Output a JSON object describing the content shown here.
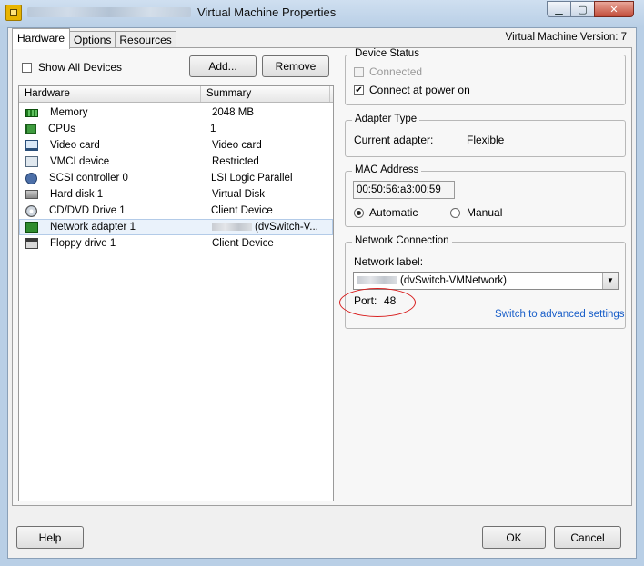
{
  "window": {
    "title": "Virtual Machine Properties",
    "controls": {
      "minimize": "▁",
      "maximize": "▢",
      "close": "✕"
    }
  },
  "tabs": [
    {
      "label": "Hardware",
      "active": true
    },
    {
      "label": "Options",
      "active": false
    },
    {
      "label": "Resources",
      "active": false
    }
  ],
  "vm_version": "Virtual Machine Version: 7",
  "left": {
    "show_all_devices_label": "Show All Devices",
    "add_button": "Add...",
    "remove_button": "Remove",
    "columns": {
      "hardware": "Hardware",
      "summary": "Summary"
    },
    "devices": [
      {
        "name": "Memory",
        "summary": "2048 MB",
        "icon": "memory-icon"
      },
      {
        "name": "CPUs",
        "summary": "1",
        "icon": "cpu-icon"
      },
      {
        "name": "Video card",
        "summary": "Video card",
        "icon": "monitor-icon"
      },
      {
        "name": "VMCI device",
        "summary": "Restricted",
        "icon": "vmci-icon"
      },
      {
        "name": "SCSI controller 0",
        "summary": "LSI Logic Parallel",
        "icon": "scsi-icon"
      },
      {
        "name": "Hard disk 1",
        "summary": "Virtual Disk",
        "icon": "harddisk-icon"
      },
      {
        "name": "CD/DVD Drive 1",
        "summary": "Client Device",
        "icon": "cdrom-icon"
      },
      {
        "name": "Network adapter 1",
        "summary": "(dvSwitch-V...",
        "icon": "network-adapter-icon",
        "selected": true
      },
      {
        "name": "Floppy drive 1",
        "summary": "Client Device",
        "icon": "floppy-icon"
      }
    ]
  },
  "device_status": {
    "title": "Device Status",
    "connected_label": "Connected",
    "connect_at_power_on_label": "Connect at power on",
    "check_mark": "✔"
  },
  "adapter_type": {
    "title": "Adapter Type",
    "current_adapter_label": "Current adapter:",
    "current_adapter_value": "Flexible"
  },
  "mac_address": {
    "title": "MAC Address",
    "value": "00:50:56:a3:00:59",
    "automatic_label": "Automatic",
    "manual_label": "Manual"
  },
  "network_connection": {
    "title": "Network Connection",
    "network_label_label": "Network label:",
    "network_label_value": "(dvSwitch-VMNetwork)",
    "dropdown_arrow": "▼",
    "port_label": "Port:",
    "port_value": "48",
    "advanced_link": "Switch to advanced settings"
  },
  "footer": {
    "help_button": "Help",
    "ok_button": "OK",
    "cancel_button": "Cancel"
  },
  "colors": {
    "annotation_circle": "#d81e1e",
    "link": "#1a5fc9"
  }
}
